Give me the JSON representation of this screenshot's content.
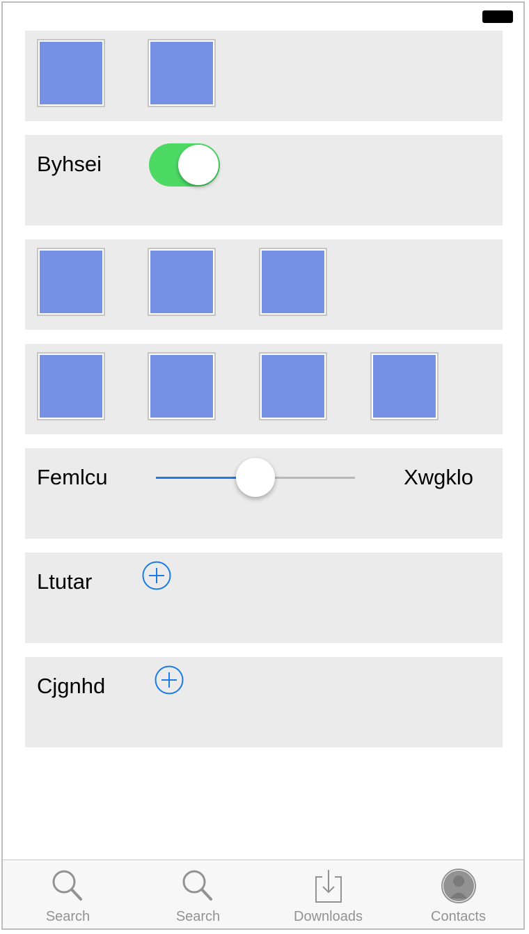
{
  "status_bar": {
    "battery_icon": "battery-full-icon"
  },
  "rows": {
    "row2": {
      "label": "Byhsei",
      "toggle_on": true
    },
    "row5": {
      "label_left": "Femlcu",
      "label_right": "Xwgklo",
      "slider_value_fraction": 0.5
    },
    "row6": {
      "label": "Ltutar",
      "button_icon": "add-circle-icon"
    },
    "row7": {
      "label": "Cjgnhd",
      "button_icon": "add-circle-icon"
    }
  },
  "image_rows": {
    "row1_count": 2,
    "row3_count": 3,
    "row4_count": 4,
    "tile_color": "#7690e4"
  },
  "tabbar": {
    "tabs": [
      {
        "label": "Search",
        "icon": "search-icon"
      },
      {
        "label": "Search",
        "icon": "search-icon"
      },
      {
        "label": "Downloads",
        "icon": "download-icon"
      },
      {
        "label": "Contacts",
        "icon": "contact-icon"
      }
    ]
  },
  "colors": {
    "accent": "#1a7ae6",
    "toggle_on": "#4cd964",
    "row_bg": "#ebebeb"
  }
}
